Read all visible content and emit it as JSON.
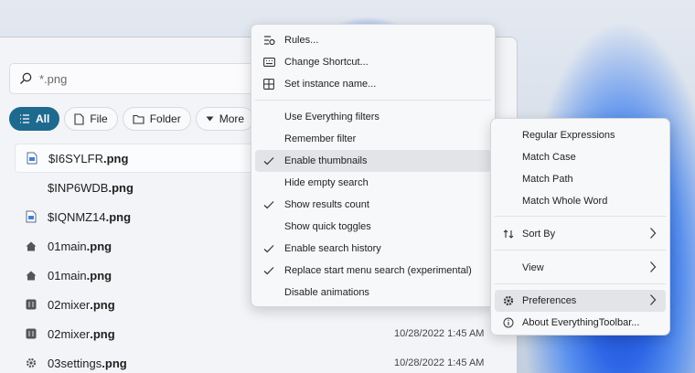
{
  "search": {
    "placeholder": "*.png"
  },
  "filters": [
    {
      "label": "All",
      "icon": "list-icon",
      "active": true
    },
    {
      "label": "File",
      "icon": "file-icon"
    },
    {
      "label": "Folder",
      "icon": "folder-icon"
    },
    {
      "label": "More",
      "icon": "caret-down-icon"
    }
  ],
  "results": [
    {
      "prefix": "$I6SYLFR",
      "ext": ".png",
      "date": "",
      "icon": "image-file-icon"
    },
    {
      "prefix": "$INP6WDB",
      "ext": ".png",
      "date": "",
      "icon": ""
    },
    {
      "prefix": "$IQNMZ14",
      "ext": ".png",
      "date": "",
      "icon": "image-file-icon"
    },
    {
      "prefix": "01main",
      "ext": ".png",
      "date": "",
      "icon": "home-icon"
    },
    {
      "prefix": "01main",
      "ext": ".png",
      "date": "",
      "icon": "home-icon"
    },
    {
      "prefix": "02mixer",
      "ext": ".png",
      "date": "",
      "icon": "mixer-icon"
    },
    {
      "prefix": "02mixer",
      "ext": ".png",
      "date": "10/28/2022 1:45 AM",
      "icon": "mixer-icon"
    },
    {
      "prefix": "03settings",
      "ext": ".png",
      "date": "10/28/2022 1:45 AM",
      "icon": "gear-icon"
    }
  ],
  "main_menu": {
    "items": [
      {
        "label": "Rules...",
        "icon": "rules-icon"
      },
      {
        "label": "Change Shortcut...",
        "icon": "keyboard-icon"
      },
      {
        "label": "Set instance name...",
        "icon": "instance-icon"
      },
      {
        "label": "Use Everything filters",
        "checked": false
      },
      {
        "label": "Remember filter",
        "checked": false
      },
      {
        "label": "Enable thumbnails",
        "checked": true
      },
      {
        "label": "Hide empty search",
        "checked": false
      },
      {
        "label": "Show results count",
        "checked": true
      },
      {
        "label": "Show quick toggles",
        "checked": false
      },
      {
        "label": "Enable search history",
        "checked": true
      },
      {
        "label": "Replace start menu search (experimental)",
        "checked": true
      },
      {
        "label": "Disable animations",
        "checked": false
      }
    ]
  },
  "sub_menu": {
    "items": [
      {
        "label": "Regular Expressions"
      },
      {
        "label": "Match Case"
      },
      {
        "label": "Match Path"
      },
      {
        "label": "Match Whole Word"
      },
      {
        "label": "Sort By",
        "icon": "sort-icon",
        "submenu": true
      },
      {
        "label": "View",
        "submenu": true
      },
      {
        "label": "Preferences",
        "icon": "gear-icon",
        "submenu": true
      },
      {
        "label": "About EverythingToolbar...",
        "icon": "info-icon"
      }
    ]
  },
  "colors": {
    "accent": "#1e6a8f",
    "highlight": "#e2e4e8"
  }
}
